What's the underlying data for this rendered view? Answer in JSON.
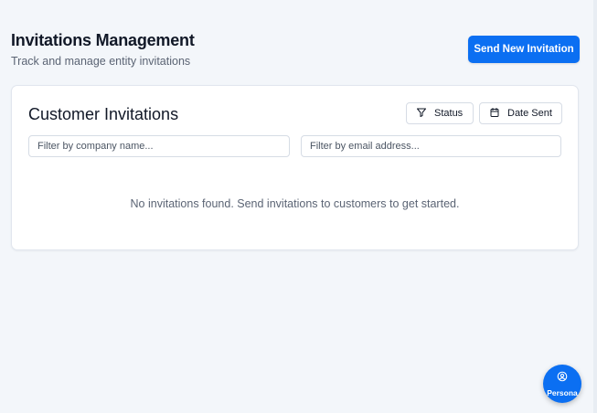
{
  "header": {
    "title": "Invitations Management",
    "subtitle": "Track and manage entity invitations",
    "send_button_label": "Send New Invitation"
  },
  "card": {
    "title": "Customer Invitations",
    "status_button_label": "Status",
    "date_button_label": "Date Sent",
    "company_filter_placeholder": "Filter by company name...",
    "email_filter_placeholder": "Filter by email address...",
    "empty_message": "No invitations found. Send invitations to customers to get started."
  },
  "fab": {
    "label": "Persona",
    "icon": "user-circle-icon"
  },
  "colors": {
    "accent": "#0b6ff2",
    "background": "#f3f6fa"
  }
}
